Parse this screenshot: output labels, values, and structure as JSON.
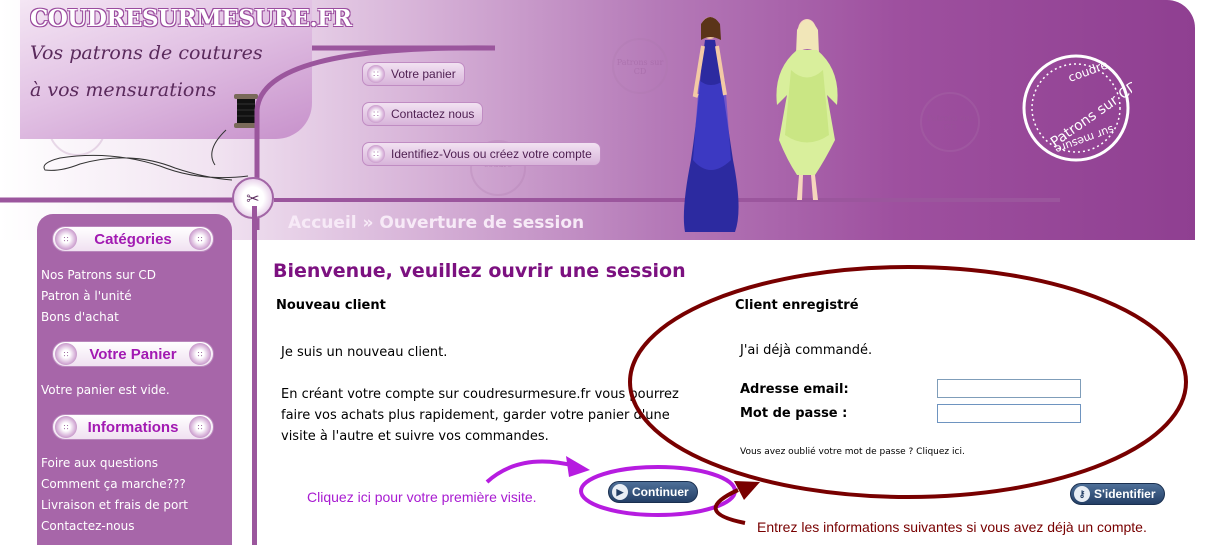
{
  "logo": {
    "title": "COUDRESURMESURE.FR",
    "tagline_line1": "Vos patrons de coutures",
    "tagline_line2": "à vos mensurations"
  },
  "nav": {
    "items": [
      {
        "label": "Votre panier"
      },
      {
        "label": "Contactez nous"
      },
      {
        "label": "Identifiez-Vous ou créez votre compte"
      }
    ]
  },
  "breadcrumb": "Accueil » Ouverture de session",
  "badge": {
    "line_top": "coudre",
    "line_mid": "Patrons sur CD",
    "line_bottom": "sur mesure"
  },
  "watermark": {
    "text": "Patrons sur CD",
    "small": "coudre"
  },
  "sidebar": {
    "categories": {
      "title": "Catégories",
      "links": [
        "Nos Patrons sur CD",
        "Patron à l'unité",
        "Bons d'achat"
      ]
    },
    "cart": {
      "title": "Votre Panier",
      "text": "Votre panier est vide."
    },
    "info": {
      "title": "Informations",
      "links": [
        "Foire aux questions",
        "Comment ça marche???",
        "Livraison et frais de port",
        "Contactez-nous"
      ]
    }
  },
  "main": {
    "heading": "Bienvenue, veuillez ouvrir une session",
    "new_client": {
      "title": "Nouveau client",
      "line1": "Je suis un nouveau client.",
      "line2": "En créant votre compte sur coudresurmesure.fr vous pourrez",
      "line3": "faire vos achats plus rapidement, garder votre panier d'une",
      "line4": "visite à l'autre et suivre vos commandes.",
      "continue_label": "Continuer"
    },
    "registered": {
      "title": "Client enregistré",
      "intro": "J'ai déjà commandé.",
      "email_label": "Adresse email:",
      "email_value": "",
      "password_label": "Mot de passe :",
      "password_value": "",
      "forgot": "Vous avez oublié votre mot de passe ? Cliquez ici.",
      "login_label": "S'identifier"
    }
  },
  "annotations": {
    "first_visit": "Cliquez ici pour votre première visite.",
    "have_account": "Entrez les informations suivantes si vous avez déjà un compte."
  },
  "colors": {
    "purple_note": "#a81bd1",
    "maroon_note": "#780000",
    "brand_purple": "#9b569d"
  }
}
